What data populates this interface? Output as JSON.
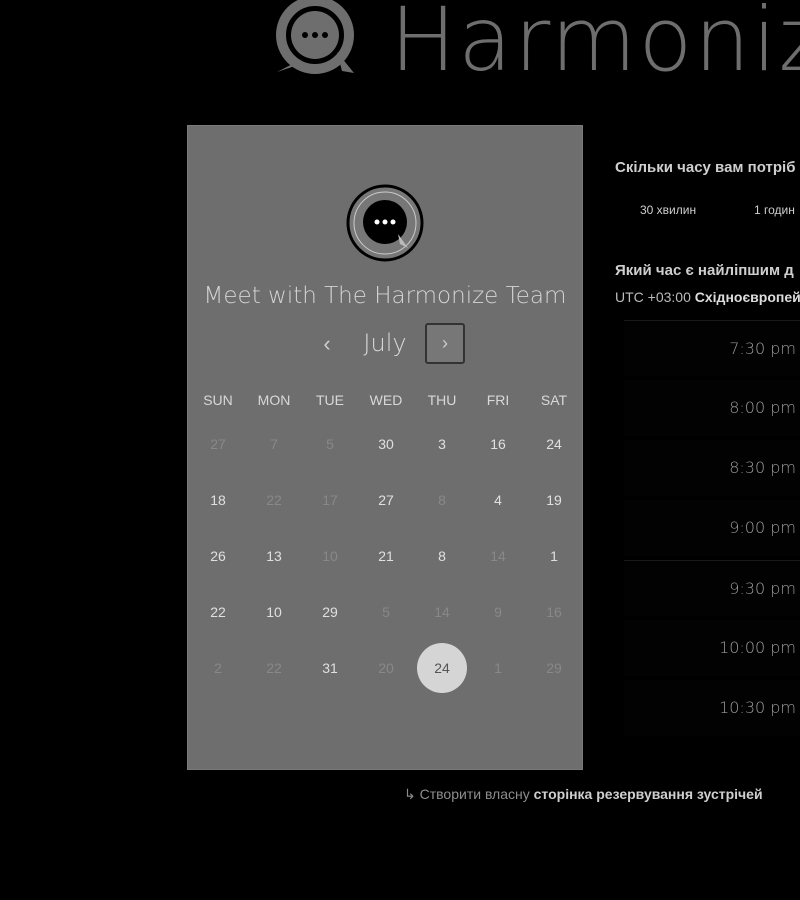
{
  "header": {
    "brand": "Harmoniz"
  },
  "card": {
    "meeting_title": "Meet with The Harmonize Team",
    "month": "July",
    "prev_label": "‹",
    "next_label": "›",
    "weekdays": [
      "SUN",
      "MON",
      "TUE",
      "WED",
      "THU",
      "FRI",
      "SAT"
    ],
    "weeks": [
      [
        {
          "d": "27",
          "on": false
        },
        {
          "d": "7",
          "on": false
        },
        {
          "d": "5",
          "on": false
        },
        {
          "d": "30",
          "on": true
        },
        {
          "d": "3",
          "on": true
        },
        {
          "d": "16",
          "on": true
        },
        {
          "d": "24",
          "on": true
        }
      ],
      [
        {
          "d": "18",
          "on": true
        },
        {
          "d": "22",
          "on": false
        },
        {
          "d": "17",
          "on": false
        },
        {
          "d": "27",
          "on": true
        },
        {
          "d": "8",
          "on": false
        },
        {
          "d": "4",
          "on": true
        },
        {
          "d": "19",
          "on": true
        }
      ],
      [
        {
          "d": "26",
          "on": true
        },
        {
          "d": "13",
          "on": true
        },
        {
          "d": "10",
          "on": false
        },
        {
          "d": "21",
          "on": true
        },
        {
          "d": "8",
          "on": true
        },
        {
          "d": "14",
          "on": false
        },
        {
          "d": "1",
          "on": true
        }
      ],
      [
        {
          "d": "22",
          "on": true
        },
        {
          "d": "10",
          "on": true
        },
        {
          "d": "29",
          "on": true
        },
        {
          "d": "5",
          "on": false
        },
        {
          "d": "14",
          "on": false
        },
        {
          "d": "9",
          "on": false
        },
        {
          "d": "16",
          "on": false
        }
      ],
      [
        {
          "d": "2",
          "on": false
        },
        {
          "d": "22",
          "on": false
        },
        {
          "d": "31",
          "on": true
        },
        {
          "d": "20",
          "on": false
        },
        {
          "d": "24",
          "on": true,
          "selected": true
        },
        {
          "d": "1",
          "on": false
        },
        {
          "d": "29",
          "on": false
        }
      ]
    ]
  },
  "footer": {
    "powered_prefix": "Створити власну ",
    "powered_bold": "сторінка резервування зустрічей"
  },
  "panel": {
    "duration_question": "Скільки часу вам потріб",
    "duration_options": [
      "30 хвилин",
      "1 годин"
    ],
    "time_question": "Який час є найліпшим д",
    "tz_prefix": "UTC +03:00 ",
    "tz_name": "Східноєвропей",
    "slots": [
      "7:30 pm",
      "8:00 pm",
      "8:30 pm",
      "9:00 pm",
      "9:30 pm",
      "10:00 pm",
      "10:30 pm"
    ]
  },
  "colors": {
    "background": "#000000",
    "card": "#6e6e6e",
    "selected_day": "#d5d5d5"
  }
}
